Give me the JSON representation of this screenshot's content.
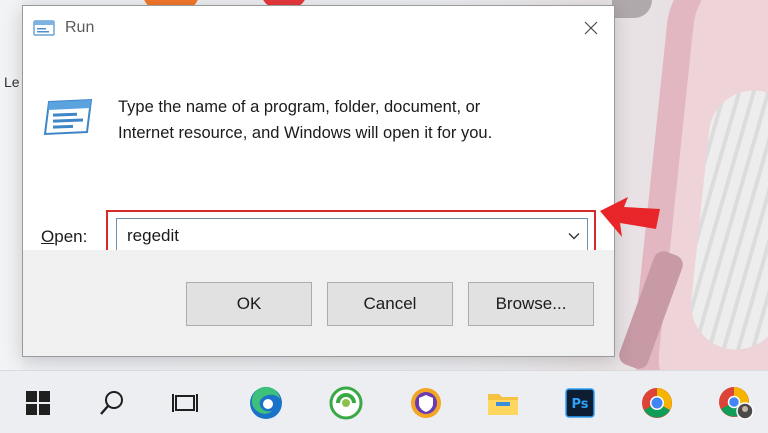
{
  "desktop": {
    "partial_label": "Le"
  },
  "dialog": {
    "title": "Run",
    "description_line1": "Type the name of a program, folder, document, or",
    "description_line2": "Internet resource, and Windows will open it for you.",
    "open_label_accel": "O",
    "open_label_rest": "pen:",
    "open_value": "regedit",
    "buttons": {
      "ok": "OK",
      "cancel": "Cancel",
      "browse": "Browse..."
    }
  },
  "colors": {
    "highlight": "#d62b2b",
    "arrow": "#e8262a"
  },
  "taskbar": {
    "items": [
      "windows-start-icon",
      "search-icon",
      "task-view-icon",
      "edge-icon",
      "coccoc-icon",
      "vpn-shield-icon",
      "file-explorer-icon",
      "photoshop-icon",
      "chrome-icon",
      "chrome-profile-icon"
    ],
    "photoshop_label": "Ps"
  }
}
